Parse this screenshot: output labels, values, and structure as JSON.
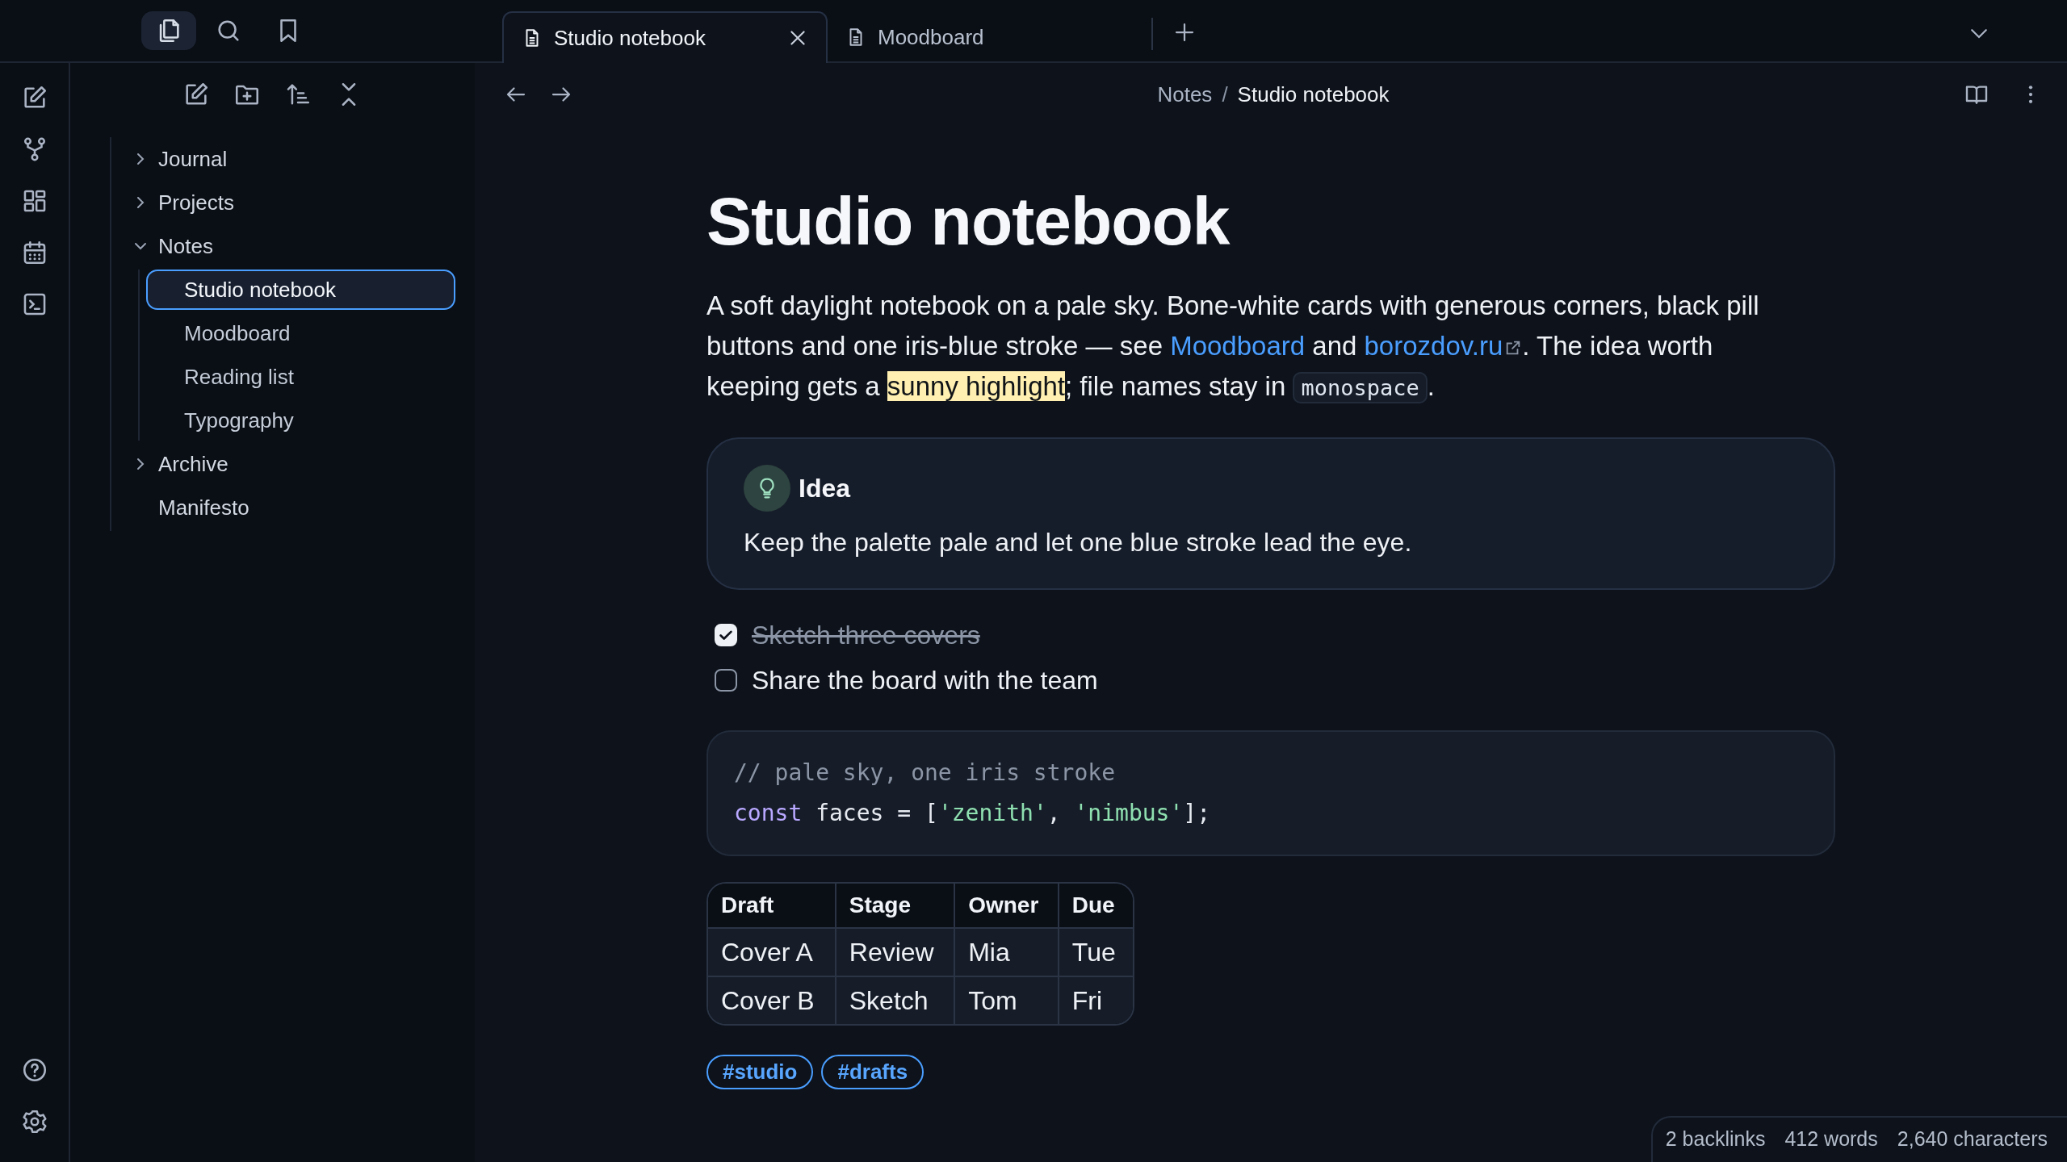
{
  "sidebar_tabs": [
    {
      "kind": "files",
      "selected": true
    },
    {
      "kind": "search",
      "selected": false
    },
    {
      "kind": "bookmarks",
      "selected": false
    }
  ],
  "tabs": [
    {
      "title": "Studio notebook",
      "selected": true
    },
    {
      "title": "Moodboard",
      "selected": false
    }
  ],
  "file_tree": [
    {
      "label": "Journal",
      "kind": "folder",
      "expanded": false,
      "selected": false
    },
    {
      "label": "Projects",
      "kind": "folder",
      "expanded": false,
      "selected": false
    },
    {
      "label": "Notes",
      "kind": "folder",
      "expanded": true,
      "selected": false,
      "children": [
        {
          "label": "Studio notebook",
          "selected": true
        },
        {
          "label": "Moodboard",
          "selected": false
        },
        {
          "label": "Reading list",
          "selected": false
        },
        {
          "label": "Typography",
          "selected": false
        }
      ]
    },
    {
      "label": "Archive",
      "kind": "folder",
      "expanded": false,
      "selected": false
    },
    {
      "label": "Manifesto",
      "kind": "file",
      "selected": false
    }
  ],
  "breadcrumb": {
    "parent": "Notes",
    "separator": "/",
    "current": "Studio notebook"
  },
  "note": {
    "title": "Studio notebook",
    "paragraph": [
      {
        "kind": "text",
        "text": "A soft daylight notebook on a pale sky. Bone-white cards with generous corners, black pill buttons and one iris-blue stroke — see "
      },
      {
        "kind": "link",
        "text": "Moodboard"
      },
      {
        "kind": "text",
        "text": " and "
      },
      {
        "kind": "external_link",
        "text": "borozdov.ru"
      },
      {
        "kind": "text",
        "text": ". The idea worth keeping gets a "
      },
      {
        "kind": "highlight",
        "text": "sunny highlight"
      },
      {
        "kind": "text",
        "text": "; file names stay in "
      },
      {
        "kind": "code",
        "text": "monospace"
      },
      {
        "kind": "text",
        "text": "."
      }
    ],
    "callout": {
      "title": "Idea",
      "body": "Keep the palette pale and let one blue stroke lead the eye."
    },
    "tasks": [
      {
        "text": "Sketch three covers",
        "checked": true
      },
      {
        "text": "Share the board with the team",
        "checked": false
      }
    ],
    "code_lines": [
      [
        {
          "kind": "comment",
          "text": "// pale sky, one iris stroke"
        }
      ],
      [
        {
          "kind": "keyword",
          "text": "const"
        },
        {
          "kind": "plain",
          "text": " faces = ["
        },
        {
          "kind": "string",
          "text": "'zenith'"
        },
        {
          "kind": "plain",
          "text": ", "
        },
        {
          "kind": "string",
          "text": "'nimbus'"
        },
        {
          "kind": "plain",
          "text": "];"
        }
      ]
    ],
    "table": {
      "columns": [
        "Draft",
        "Stage",
        "Owner",
        "Due"
      ],
      "rows": [
        [
          "Cover A",
          "Review",
          "Mia",
          "Tue"
        ],
        [
          "Cover B",
          "Sketch",
          "Tom",
          "Fri"
        ]
      ]
    },
    "tags": [
      "#studio",
      "#drafts"
    ]
  },
  "status_bar": [
    "2 backlinks",
    "412 words",
    "2,640 characters"
  ]
}
